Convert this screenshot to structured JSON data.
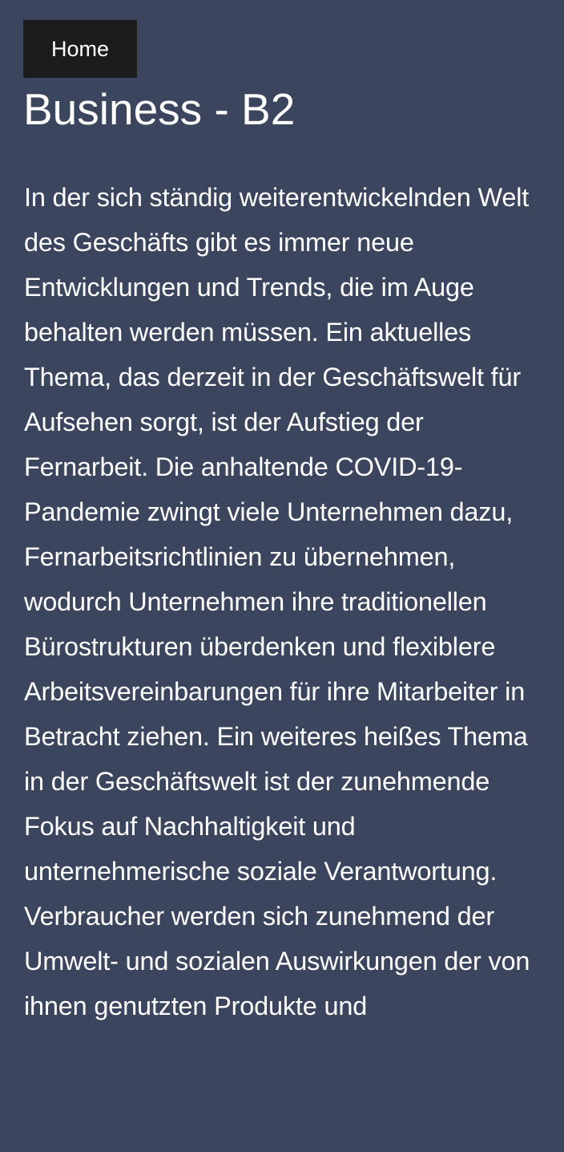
{
  "nav": {
    "home_label": "Home"
  },
  "page": {
    "title": "Business - B2",
    "body": "In der sich ständig weiterentwickelnden Welt des Geschäfts gibt es immer neue Entwicklungen und Trends, die im Auge behalten werden müssen. Ein aktuelles Thema, das derzeit in der Geschäftswelt für Aufsehen sorgt, ist der Aufstieg der Fernarbeit. Die anhaltende COVID-19-Pandemie zwingt viele Unternehmen dazu, Fernarbeitsrichtlinien zu übernehmen, wodurch Unternehmen ihre traditionellen Bürostrukturen überdenken und flexiblere Arbeitsvereinbarungen für ihre Mitarbeiter in Betracht ziehen. Ein weiteres heißes Thema in der Geschäftswelt ist der zunehmende Fokus auf Nachhaltigkeit und unternehmerische soziale Verantwortung. Verbraucher werden sich zunehmend der Umwelt- und sozialen Auswirkungen der von ihnen genutzten Produkte und"
  },
  "colors": {
    "background": "#3b455e",
    "button_background": "#1c1c1c",
    "text": "#ffffff"
  }
}
